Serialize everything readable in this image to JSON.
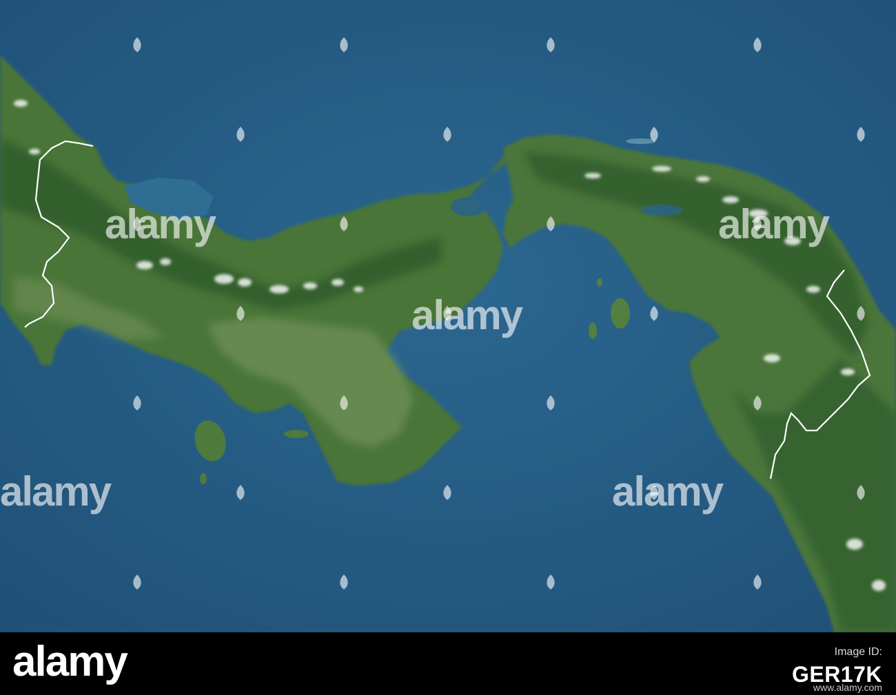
{
  "watermark": {
    "brand": "alamy"
  },
  "footer": {
    "brand": "alamy",
    "image_id_label": "Image ID:",
    "image_id": "GER17K",
    "url": "www.alamy.com"
  },
  "map": {
    "colors": {
      "ocean": "#235b85",
      "ocean_shallow": "#2f6f95",
      "land": "#4f7a3e",
      "land_dark": "#2f5a2e",
      "land_light": "#7d9563",
      "clouds": "#ffffff",
      "border": "#ffffff"
    }
  }
}
